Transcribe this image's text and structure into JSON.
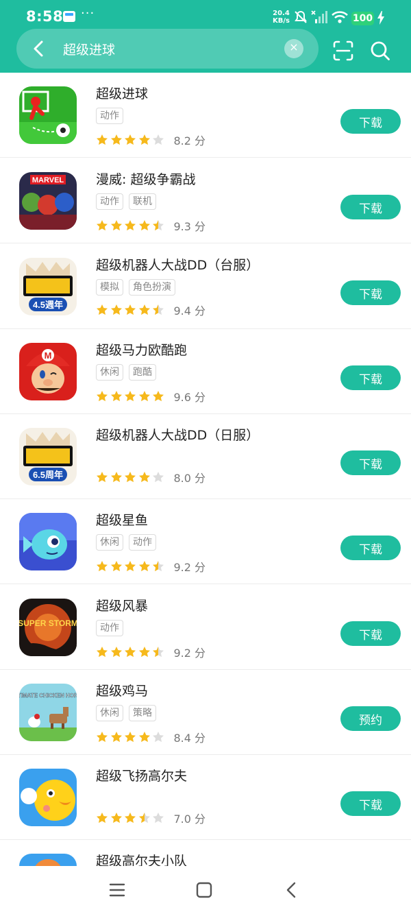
{
  "status_bar": {
    "time": "8:58",
    "net_speed_value": "20.4",
    "net_speed_unit": "KB/s",
    "battery": "100"
  },
  "search": {
    "query": "超级进球",
    "clear_glyph": "×"
  },
  "colors": {
    "accent": "#1fbd9f",
    "star": "#f6b91c",
    "star_empty": "#dcdcdc"
  },
  "apps": [
    {
      "name": "超级进球",
      "tags": [
        "动作"
      ],
      "rating": 4.0,
      "score": "8.2 分",
      "button": "下载",
      "icon": "soccer-icon"
    },
    {
      "name": "漫威: 超级争霸战",
      "tags": [
        "动作",
        "联机"
      ],
      "rating": 4.5,
      "score": "9.3 分",
      "button": "下载",
      "icon": "marvel-heroes-icon",
      "icon_text": "MARVEL"
    },
    {
      "name": "超级机器人大战DD（台服）",
      "tags": [
        "模拟",
        "角色扮演"
      ],
      "rating": 4.5,
      "score": "9.4 分",
      "button": "下载",
      "icon": "robot-wars-icon",
      "icon_text": "4.5週年"
    },
    {
      "name": "超级马力欧酷跑",
      "tags": [
        "休闲",
        "跑酷"
      ],
      "rating": 5.0,
      "score": "9.6 分",
      "button": "下载",
      "icon": "mario-icon"
    },
    {
      "name": "超级机器人大战DD（日服）",
      "tags": [],
      "rating": 4.0,
      "score": "8.0 分",
      "button": "下载",
      "icon": "robot-wars-jp-icon",
      "icon_text": "6.5周年"
    },
    {
      "name": "超级星鱼",
      "tags": [
        "休闲",
        "动作"
      ],
      "rating": 4.5,
      "score": "9.2 分",
      "button": "下载",
      "icon": "star-fish-icon"
    },
    {
      "name": "超级风暴",
      "tags": [
        "动作"
      ],
      "rating": 4.5,
      "score": "9.2 分",
      "button": "下载",
      "icon": "super-storm-icon",
      "icon_text": "SUPER STORM"
    },
    {
      "name": "超级鸡马",
      "tags": [
        "休闲",
        "策略"
      ],
      "rating": 4.0,
      "score": "8.4 分",
      "button": "预约",
      "icon": "chicken-horse-icon",
      "icon_text": "ULTIMATE CHICKEN HORSE"
    },
    {
      "name": "超级飞扬高尔夫",
      "tags": [],
      "rating": 3.5,
      "score": "7.0 分",
      "button": "下载",
      "icon": "golf-bird-icon"
    },
    {
      "name": "超级高尔夫小队",
      "tags": [],
      "rating": 0,
      "score": "",
      "button": "",
      "icon": "golf-squad-icon"
    }
  ]
}
